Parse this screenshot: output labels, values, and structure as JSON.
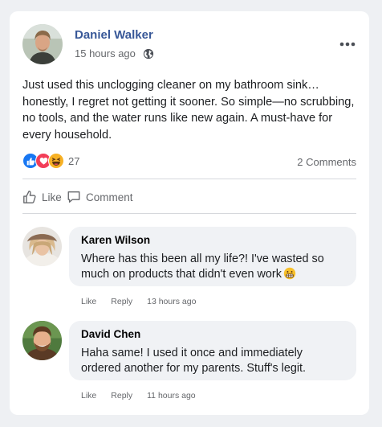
{
  "post": {
    "author": "Daniel Walker",
    "time": "15 hours ago",
    "privacy_icon": "globe-icon",
    "more_icon": "more-options-icon",
    "text": "Just used this unclogging cleaner on my bathroom sink… honestly, I regret not getting it sooner. So simple—no scrubbing, no tools, and the water runs like new again. A must-have for every household.",
    "reactions": {
      "icons": [
        "like-icon",
        "love-icon",
        "haha-icon"
      ],
      "count": "27"
    },
    "comments_count": "2 Comments",
    "actions": {
      "like": "Like",
      "comment": "Comment"
    }
  },
  "comments": [
    {
      "name": "Karen Wilson",
      "text": "Where has this been all my life?! I've wasted so much on products that didn't even work",
      "emoji": "grimacing-face-icon",
      "like": "Like",
      "reply": "Reply",
      "time": "13 hours ago"
    },
    {
      "name": "David Chen",
      "text": "Haha same! I used it once and immediately ordered another for my parents. Stuff's legit.",
      "like": "Like",
      "reply": "Reply",
      "time": "11 hours ago"
    }
  ],
  "colors": {
    "author_name": "#385898",
    "secondary_text": "#65676b",
    "bubble_bg": "#f0f2f5",
    "like_blue": "#1877f2",
    "love_red": "#f33e58",
    "haha_yellow": "#f7b125"
  }
}
